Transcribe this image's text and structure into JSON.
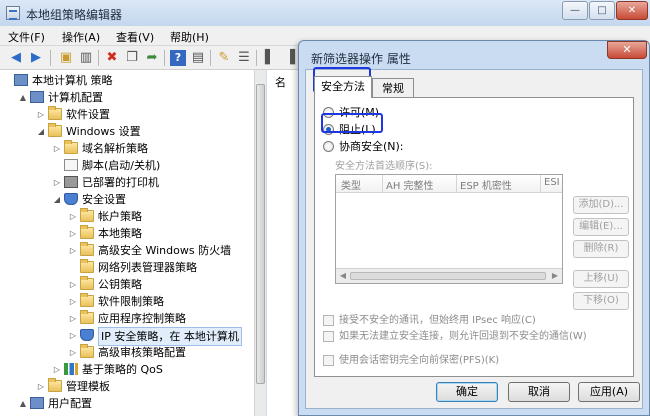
{
  "main_window": {
    "title": "本地组策略编辑器",
    "controls": {
      "minimize": "—",
      "maximize": "□",
      "close": "✕"
    },
    "menu": [
      "文件(F)",
      "操作(A)",
      "查看(V)",
      "帮助(H)"
    ],
    "toolbar_icons": [
      "back-icon",
      "forward-icon",
      "up-folder-icon",
      "show-hide-tree-icon",
      "delete-icon",
      "copy-icon",
      "export-icon",
      "help-icon",
      "properties-icon",
      "new-policy-icon",
      "new-filter-icon",
      "assign-icon",
      "unassign-icon",
      "manage-icon"
    ],
    "right_pane": {
      "column_header": "名"
    },
    "tree": [
      {
        "label": "本地计算机 策略",
        "icon": "pc",
        "level": 0,
        "arrow": ""
      },
      {
        "label": "计算机配置",
        "icon": "pc",
        "level": 1,
        "arrow": "▲"
      },
      {
        "label": "软件设置",
        "icon": "folder",
        "level": 2,
        "arrow": "▷"
      },
      {
        "label": "Windows 设置",
        "icon": "folder",
        "level": 2,
        "arrow": "◢"
      },
      {
        "label": "域名解析策略",
        "icon": "folder",
        "level": 3,
        "arrow": "▷"
      },
      {
        "label": "脚本(启动/关机)",
        "icon": "doc",
        "level": 3,
        "arrow": ""
      },
      {
        "label": "已部署的打印机",
        "icon": "printer",
        "level": 3,
        "arrow": "▷"
      },
      {
        "label": "安全设置",
        "icon": "shield",
        "level": 3,
        "arrow": "◢"
      },
      {
        "label": "帐户策略",
        "icon": "folder",
        "level": 4,
        "arrow": "▷"
      },
      {
        "label": "本地策略",
        "icon": "folder",
        "level": 4,
        "arrow": "▷"
      },
      {
        "label": "高级安全 Windows 防火墙",
        "icon": "folder",
        "level": 4,
        "arrow": "▷"
      },
      {
        "label": "网络列表管理器策略",
        "icon": "folder",
        "level": 4,
        "arrow": ""
      },
      {
        "label": "公钥策略",
        "icon": "folder",
        "level": 4,
        "arrow": "▷"
      },
      {
        "label": "软件限制策略",
        "icon": "folder",
        "level": 4,
        "arrow": "▷"
      },
      {
        "label": "应用程序控制策略",
        "icon": "folder",
        "level": 4,
        "arrow": "▷"
      },
      {
        "label": "IP 安全策略，在 本地计算机",
        "icon": "shield",
        "level": 4,
        "arrow": "▷",
        "selected": true
      },
      {
        "label": "高级审核策略配置",
        "icon": "folder",
        "level": 4,
        "arrow": "▷"
      },
      {
        "label": "基于策略的 QoS",
        "icon": "chart",
        "level": 3,
        "arrow": "▷"
      },
      {
        "label": "管理模板",
        "icon": "folder",
        "level": 2,
        "arrow": "▷"
      },
      {
        "label": "用户配置",
        "icon": "pc",
        "level": 1,
        "arrow": "▲"
      }
    ]
  },
  "dialog": {
    "title": "新筛选器操作 属性",
    "close": "✕",
    "tabs": [
      "安全方法",
      "常规"
    ],
    "radios": [
      {
        "label": "许可(M)",
        "checked": false
      },
      {
        "label": "阻止(L)",
        "checked": true
      },
      {
        "label": "协商安全(N):",
        "checked": false
      }
    ],
    "order_label": "安全方法首选顺序(S):",
    "list_columns": [
      "类型",
      "AH 完整性",
      "ESP 机密性",
      "ESI"
    ],
    "side_buttons": [
      "添加(D)...",
      "编辑(E)...",
      "删除(R)",
      "上移(U)",
      "下移(O)"
    ],
    "checkboxes": [
      "接受不安全的通讯，但始终用 IPsec 响应(C)",
      "如果无法建立安全连接，则允许回退到不安全的通信(W)",
      "使用会话密钥完全向前保密(PFS)(K)"
    ],
    "buttons": {
      "ok": "确定",
      "cancel": "取消",
      "apply": "应用(A)"
    }
  }
}
